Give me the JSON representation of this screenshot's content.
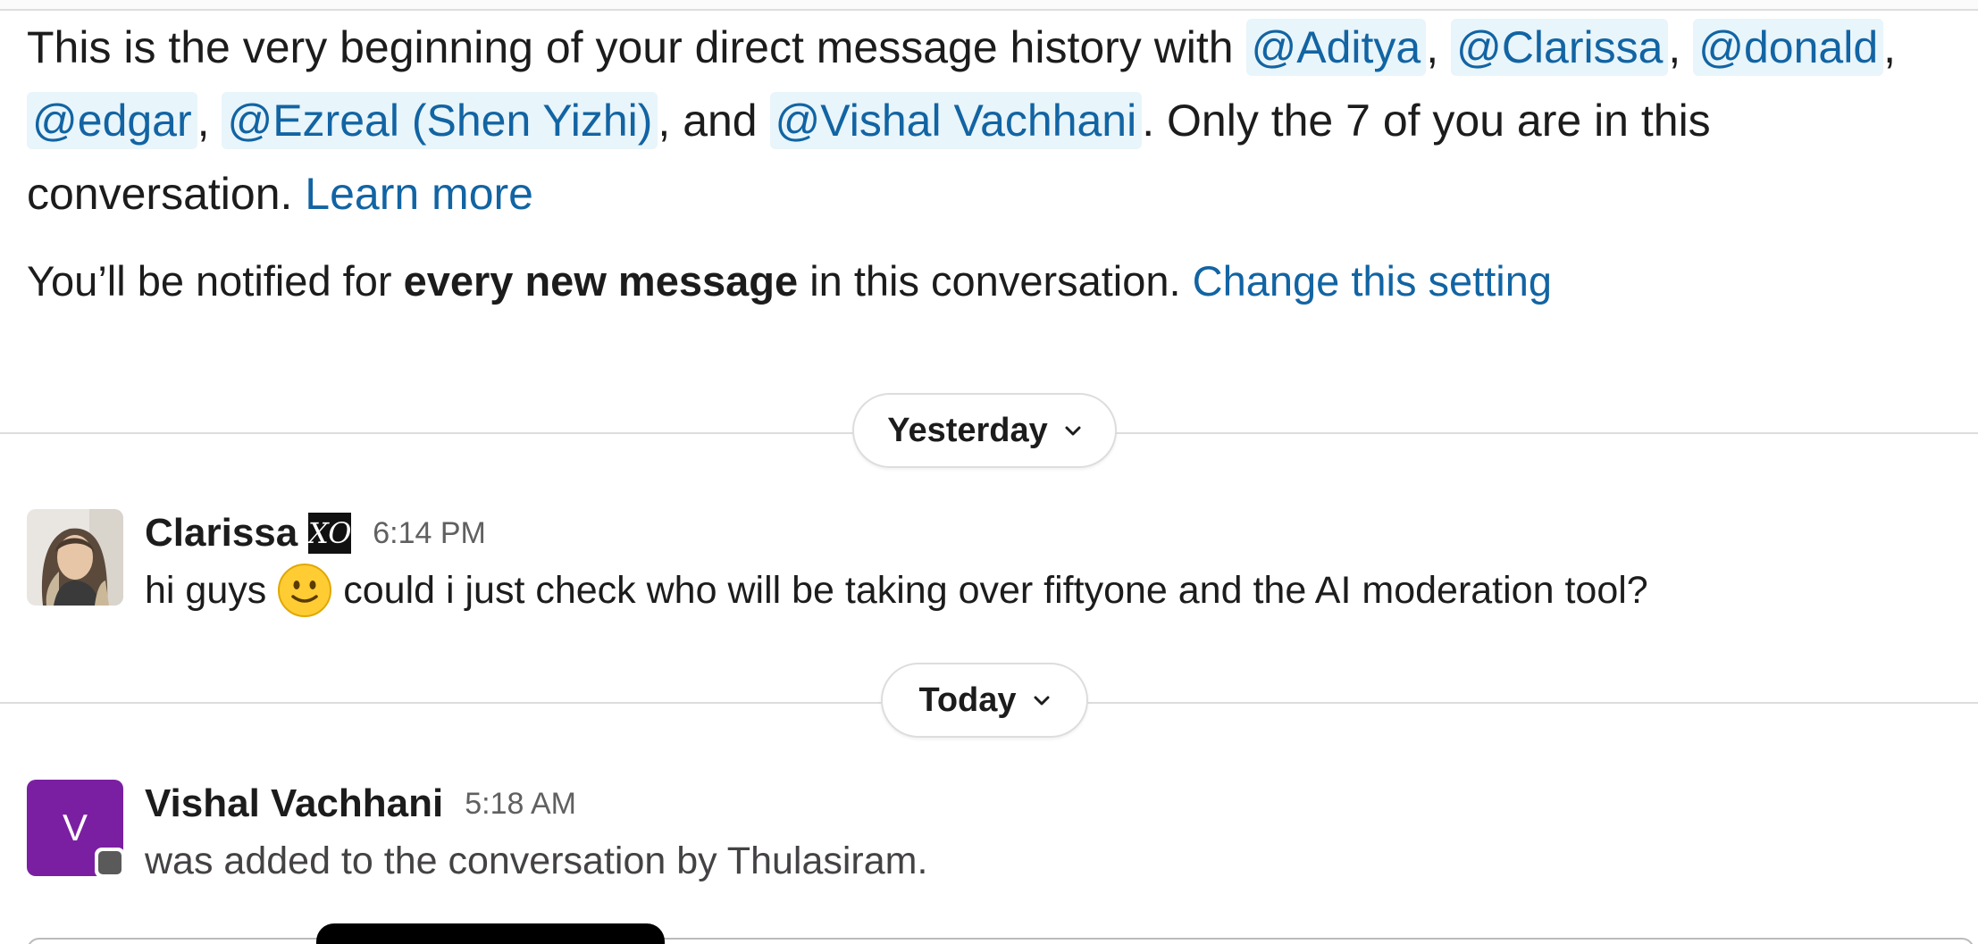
{
  "intro": {
    "prefix": "This is the very beginning of your direct message history with ",
    "mentions": [
      "@Aditya",
      "@Clarissa",
      "@donald",
      "@edgar",
      "@Ezreal (Shen Yizhi)",
      "@Vishal Vachhani"
    ],
    "sep_comma": ",",
    "and_text": ", and ",
    "suffix": ". Only the 7 of you are in this conversation. ",
    "learn_more": "Learn more"
  },
  "notify": {
    "prefix": "You’ll be notified for ",
    "bold": "every new message",
    "middle": " in this conversation. ",
    "link": "Change this setting"
  },
  "dividers": {
    "yesterday": "Yesterday",
    "today": "Today"
  },
  "messages": [
    {
      "sender": "Clarissa",
      "badge": "XO",
      "time": "6:14 PM",
      "text_before": "hi guys",
      "text_after": "could i just check who will be taking over fiftyone and the AI moderation tool?"
    },
    {
      "sender": "Vishal Vachhani",
      "avatar_letter": "V",
      "avatar_color": "#7b1fa2",
      "time": "5:18 AM",
      "text": "was added to the conversation by Thulasiram."
    }
  ],
  "colors": {
    "link": "#1264a3",
    "mention_bg": "#e8f5fa",
    "divider": "#dddddd"
  }
}
